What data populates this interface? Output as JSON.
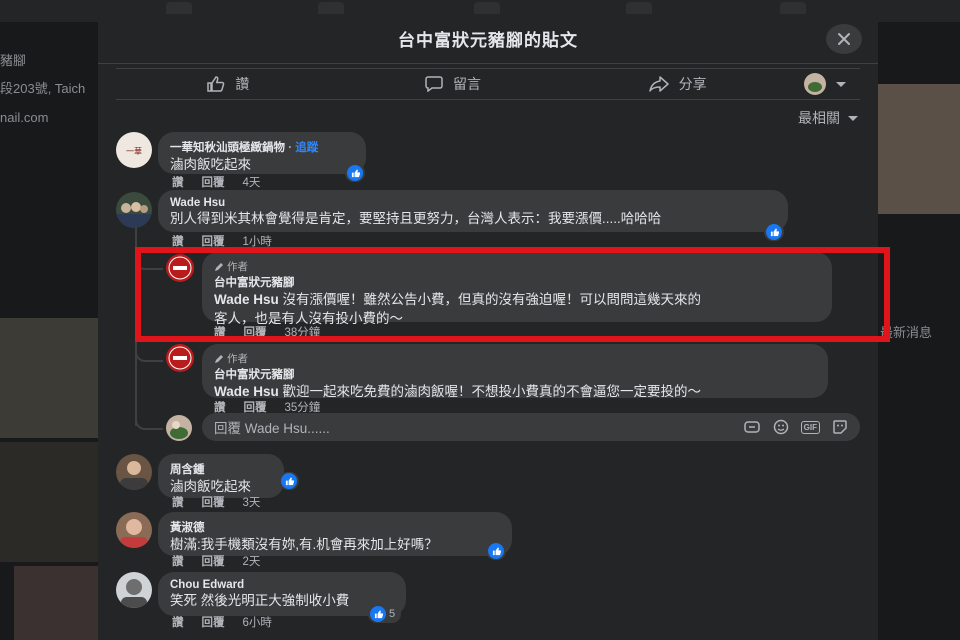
{
  "background": {
    "left_fragments": [
      "豬腳",
      "段203號, Taich",
      "nail.com"
    ],
    "right_fragments": [
      "最新消息"
    ]
  },
  "modal": {
    "title": "台中富狀元豬腳的貼文",
    "actions": {
      "like": "讚",
      "comment": "留言",
      "share": "分享"
    },
    "sort_label": "最相關",
    "reply_placeholder": "回覆 Wade Hsu......",
    "gif_label": "GIF"
  },
  "comments": [
    {
      "name": "一華知秋汕頭極緻鍋物",
      "follow": "追蹤",
      "text": "滷肉飯吃起來",
      "like": "讚",
      "reply": "回覆",
      "time": "4天"
    },
    {
      "name": "Wade Hsu",
      "text": "別人得到米其林會覺得是肯定，要堅持且更努力，台灣人表示：我要漲價.....哈哈哈",
      "like": "讚",
      "reply": "回覆",
      "time": "1小時"
    },
    {
      "author_tag": "作者",
      "name": "台中富狀元豬腳",
      "mention": "Wade Hsu",
      "text_line1": " 沒有漲價喔！雖然公告小費，但真的沒有強迫喔！可以問問這幾天來的",
      "text_line2": "客人，也是有人沒有投小費的～",
      "like": "讚",
      "reply": "回覆",
      "time": "38分鐘"
    },
    {
      "author_tag": "作者",
      "name": "台中富狀元豬腳",
      "mention": "Wade Hsu",
      "text_line1": " 歡迎一起來吃免費的滷肉飯喔！不想投小費真的不會逼您一定要投的～",
      "like": "讚",
      "reply": "回覆",
      "time": "35分鐘"
    },
    {
      "name": "周含鍾",
      "text": "滷肉飯吃起來",
      "like": "讚",
      "reply": "回覆",
      "time": "3天"
    },
    {
      "name": "黃淑德",
      "text": "樹滿:我手機類沒有妳,有.机會再來加上好嗎？",
      "like": "讚",
      "reply": "回覆",
      "time": "2天"
    },
    {
      "name": "Chou Edward",
      "text": "笑死 然後光明正大強制收小費",
      "like": "讚",
      "reply": "回覆",
      "time": "6小時",
      "reaction_count": "5"
    }
  ],
  "colors": {
    "accent": "#1877f2",
    "highlight": "#e0151b",
    "link": "#2d88ff"
  }
}
